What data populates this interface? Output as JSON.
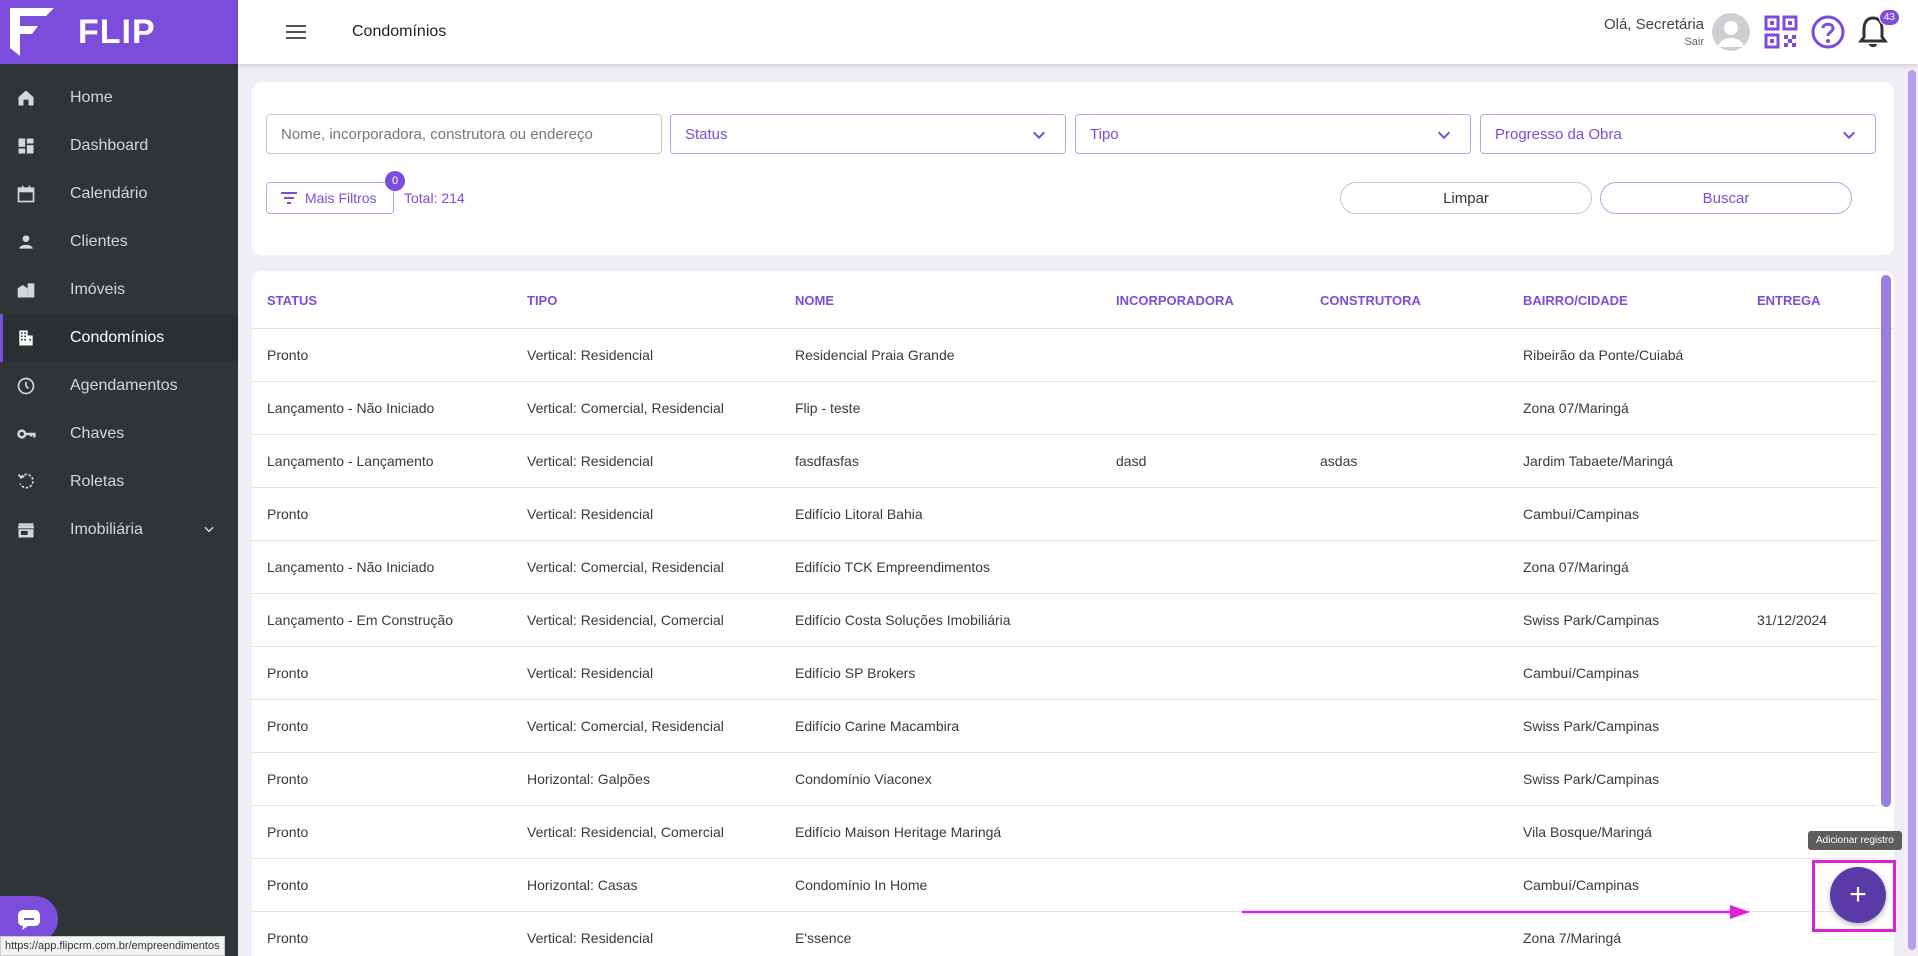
{
  "brand": {
    "name": "FLIP",
    "accent": "#7c4ddb"
  },
  "sidebar": {
    "items": [
      {
        "label": "Home",
        "icon": "home-icon"
      },
      {
        "label": "Dashboard",
        "icon": "dashboard-icon"
      },
      {
        "label": "Calendário",
        "icon": "calendar-icon"
      },
      {
        "label": "Clientes",
        "icon": "person-icon"
      },
      {
        "label": "Imóveis",
        "icon": "buildings-icon"
      },
      {
        "label": "Condomínios",
        "icon": "apartment-icon",
        "active": true
      },
      {
        "label": "Agendamentos",
        "icon": "clock-icon"
      },
      {
        "label": "Chaves",
        "icon": "key-icon"
      },
      {
        "label": "Roletas",
        "icon": "rotate-icon"
      },
      {
        "label": "Imobiliária",
        "icon": "store-icon"
      }
    ]
  },
  "header": {
    "title": "Condomínios",
    "greeting": "Olá, Secretária",
    "logout": "Sair",
    "notification_count": "43"
  },
  "filters": {
    "search_placeholder": "Nome, incorporadora, construtora ou endereço",
    "status": "Status",
    "tipo": "Tipo",
    "progresso": "Progresso da Obra",
    "more_label": "Mais Filtros",
    "more_count": "0",
    "total": "Total: 214",
    "clear_label": "Limpar",
    "search_label": "Buscar"
  },
  "table": {
    "columns": [
      "STATUS",
      "TIPO",
      "NOME",
      "INCORPORADORA",
      "CONSTRUTORA",
      "BAIRRO/CIDADE",
      "ENTREGA"
    ],
    "rows": [
      [
        "Pronto",
        "Vertical: Residencial",
        "Residencial Praia Grande",
        "",
        "",
        "Ribeirão da Ponte/Cuiabá",
        ""
      ],
      [
        "Lançamento - Não Iniciado",
        "Vertical: Comercial, Residencial",
        "Flip - teste",
        "",
        "",
        "Zona 07/Maringá",
        ""
      ],
      [
        "Lançamento - Lançamento",
        "Vertical: Residencial",
        "fasdfasfas",
        "dasd",
        "asdas",
        "Jardim Tabaete/Maringá",
        ""
      ],
      [
        "Pronto",
        "Vertical: Residencial",
        "Edifício Litoral Bahia",
        "",
        "",
        "Cambuí/Campinas",
        ""
      ],
      [
        "Lançamento - Não Iniciado",
        "Vertical: Comercial, Residencial",
        "Edifício TCK Empreendimentos",
        "",
        "",
        "Zona 07/Maringá",
        ""
      ],
      [
        "Lançamento - Em Construção",
        "Vertical: Residencial, Comercial",
        "Edifício Costa Soluções Imobiliária",
        "",
        "",
        "Swiss Park/Campinas",
        "31/12/2024"
      ],
      [
        "Pronto",
        "Vertical: Residencial",
        "Edifício SP Brokers",
        "",
        "",
        "Cambuí/Campinas",
        ""
      ],
      [
        "Pronto",
        "Vertical: Comercial, Residencial",
        "Edifício Carine Macambira",
        "",
        "",
        "Swiss Park/Campinas",
        ""
      ],
      [
        "Pronto",
        "Horizontal: Galpões",
        "Condomínio Viaconex",
        "",
        "",
        "Swiss Park/Campinas",
        ""
      ],
      [
        "Pronto",
        "Vertical: Residencial, Comercial",
        "Edifício Maison Heritage Maringá",
        "",
        "",
        "Vila Bosque/Maringá",
        ""
      ],
      [
        "Pronto",
        "Horizontal: Casas",
        "Condomínio In Home",
        "",
        "",
        "Cambuí/Campinas",
        ""
      ],
      [
        "Pronto",
        "Vertical: Residencial",
        "E'ssence",
        "",
        "",
        "Zona 7/Maringá",
        ""
      ]
    ]
  },
  "fab": {
    "tooltip": "Adicionar registro",
    "label": "+"
  },
  "status_url": "https://app.flipcrm.com.br/empreendimentos"
}
